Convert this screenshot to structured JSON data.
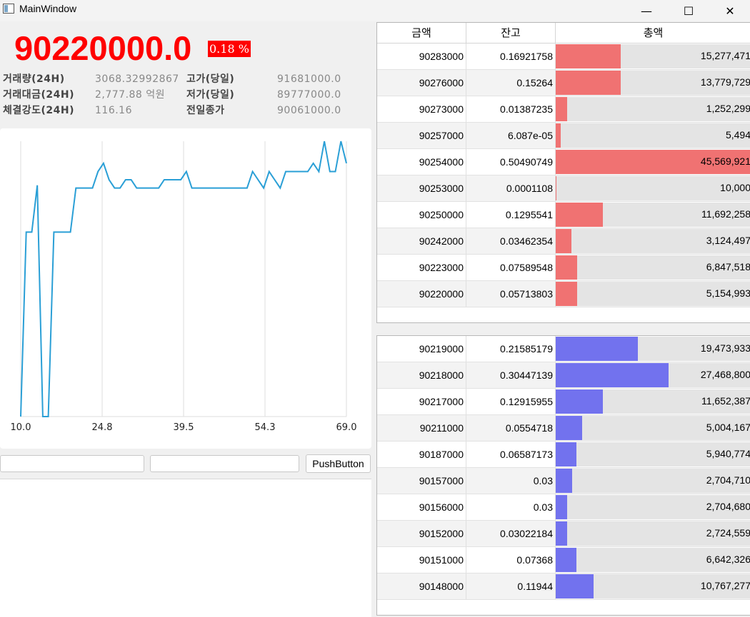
{
  "window": {
    "title": "MainWindow",
    "minimize": "—",
    "maximize": "☐",
    "close": "✕"
  },
  "ticker": {
    "price": "90220000.0",
    "change": "0.18 %"
  },
  "stats": [
    {
      "label": "거래량(24H)",
      "value": "3068.32992867"
    },
    {
      "label": "거래대금(24H)",
      "value": "2,777.88 억원"
    },
    {
      "label": "체결강도(24H)",
      "value": "116.16"
    },
    {
      "label": "고가(당일)",
      "value": "91681000.0"
    },
    {
      "label": "저가(당일)",
      "value": "89777000.0"
    },
    {
      "label": "전일종가",
      "value": "90061000.0"
    }
  ],
  "colors": {
    "price": "#ff0000",
    "ask_bar": "#f07272",
    "bid_bar": "#7272ee",
    "line": "#2a9fd6",
    "grid": "#dddddd"
  },
  "chart_data": {
    "type": "line",
    "xlim": [
      10.0,
      69.0
    ],
    "ylim": [
      0,
      100
    ],
    "x_ticks": [
      "10.0",
      "24.8",
      "39.5",
      "54.3",
      "69.0"
    ],
    "x": [
      10,
      11,
      12,
      13,
      14,
      15,
      16,
      17,
      18,
      19,
      20,
      21,
      22,
      23,
      24,
      25,
      26,
      27,
      28,
      29,
      30,
      31,
      32,
      33,
      34,
      35,
      36,
      37,
      38,
      39,
      40,
      41,
      42,
      43,
      44,
      45,
      46,
      47,
      48,
      49,
      50,
      51,
      52,
      53,
      54,
      55,
      56,
      57,
      58,
      59,
      60,
      61,
      62,
      63,
      64,
      65,
      66,
      67,
      68,
      69
    ],
    "values": [
      0,
      67,
      67,
      84,
      0,
      0,
      67,
      67,
      67,
      67,
      83,
      83,
      83,
      83,
      89,
      92,
      86,
      83,
      83,
      86,
      86,
      83,
      83,
      83,
      83,
      83,
      86,
      86,
      86,
      86,
      89,
      83,
      83,
      83,
      83,
      83,
      83,
      83,
      83,
      83,
      83,
      83,
      89,
      86,
      83,
      89,
      86,
      83,
      89,
      89,
      89,
      89,
      89,
      92,
      89,
      100,
      89,
      89,
      100,
      92
    ]
  },
  "inputs": {
    "field1": "",
    "field2": "",
    "button": "PushButton"
  },
  "asks": {
    "headers": [
      "금액",
      "잔고",
      "총액"
    ],
    "rows": [
      {
        "price": "90283000",
        "qty": "0.16921758",
        "total": "15,277,471",
        "ratio": 0.335
      },
      {
        "price": "90276000",
        "qty": "0.15264",
        "total": "13,779,729",
        "ratio": 0.332
      },
      {
        "price": "90273000",
        "qty": "0.01387235",
        "total": "1,252,299",
        "ratio": 0.06
      },
      {
        "price": "90257000",
        "qty": "6.087e-05",
        "total": "5,494",
        "ratio": 0.027
      },
      {
        "price": "90254000",
        "qty": "0.50490749",
        "total": "45,569,921",
        "ratio": 1.0
      },
      {
        "price": "90253000",
        "qty": "0.0001108",
        "total": "10,000",
        "ratio": 0.005
      },
      {
        "price": "90250000",
        "qty": "0.1295541",
        "total": "11,692,258",
        "ratio": 0.24
      },
      {
        "price": "90242000",
        "qty": "0.03462354",
        "total": "3,124,497",
        "ratio": 0.08
      },
      {
        "price": "90223000",
        "qty": "0.07589548",
        "total": "6,847,518",
        "ratio": 0.11
      },
      {
        "price": "90220000",
        "qty": "0.05713803",
        "total": "5,154,993",
        "ratio": 0.11
      }
    ]
  },
  "bids": {
    "rows": [
      {
        "price": "90219000",
        "qty": "0.21585179",
        "total": "19,473,933",
        "ratio": 0.42
      },
      {
        "price": "90218000",
        "qty": "0.30447139",
        "total": "27,468,800",
        "ratio": 0.58
      },
      {
        "price": "90217000",
        "qty": "0.12915955",
        "total": "11,652,387",
        "ratio": 0.24
      },
      {
        "price": "90211000",
        "qty": "0.0554718",
        "total": "5,004,167",
        "ratio": 0.135
      },
      {
        "price": "90187000",
        "qty": "0.06587173",
        "total": "5,940,774",
        "ratio": 0.105
      },
      {
        "price": "90157000",
        "qty": "0.03",
        "total": "2,704,710",
        "ratio": 0.085
      },
      {
        "price": "90156000",
        "qty": "0.03",
        "total": "2,704,680",
        "ratio": 0.06
      },
      {
        "price": "90152000",
        "qty": "0.03022184",
        "total": "2,724,559",
        "ratio": 0.06
      },
      {
        "price": "90151000",
        "qty": "0.07368",
        "total": "6,642,326",
        "ratio": 0.105
      },
      {
        "price": "90148000",
        "qty": "0.11944",
        "total": "10,767,277",
        "ratio": 0.195
      }
    ]
  }
}
